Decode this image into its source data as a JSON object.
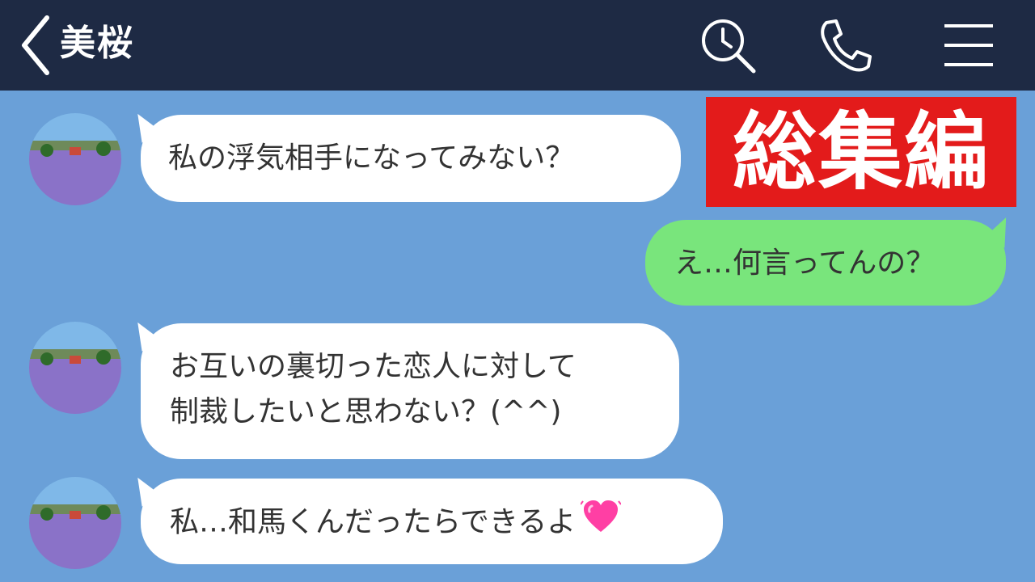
{
  "header": {
    "contact_name": "美桜",
    "back_icon": "chevron-left-icon",
    "search_icon": "search-clock-icon",
    "call_icon": "phone-icon",
    "menu_icon": "hamburger-menu-icon"
  },
  "badge": {
    "text": "総集編",
    "color": "#e31b1b"
  },
  "colors": {
    "chat_background": "#6aa0d8",
    "topbar": "#1e2a44",
    "incoming_bubble": "#ffffff",
    "outgoing_bubble": "#79e57c"
  },
  "messages": [
    {
      "from": "contact",
      "lines": [
        "私の浮気相手になってみない？"
      ]
    },
    {
      "from": "me",
      "lines": [
        "え…何言ってんの？"
      ]
    },
    {
      "from": "contact",
      "lines": [
        "お互いの裏切った恋人に対して",
        "制裁したいと思わない？(^^)"
      ]
    },
    {
      "from": "contact",
      "lines": [
        "私…和馬くんだったらできるよ"
      ],
      "emoji": "sparkling-heart-icon"
    }
  ]
}
